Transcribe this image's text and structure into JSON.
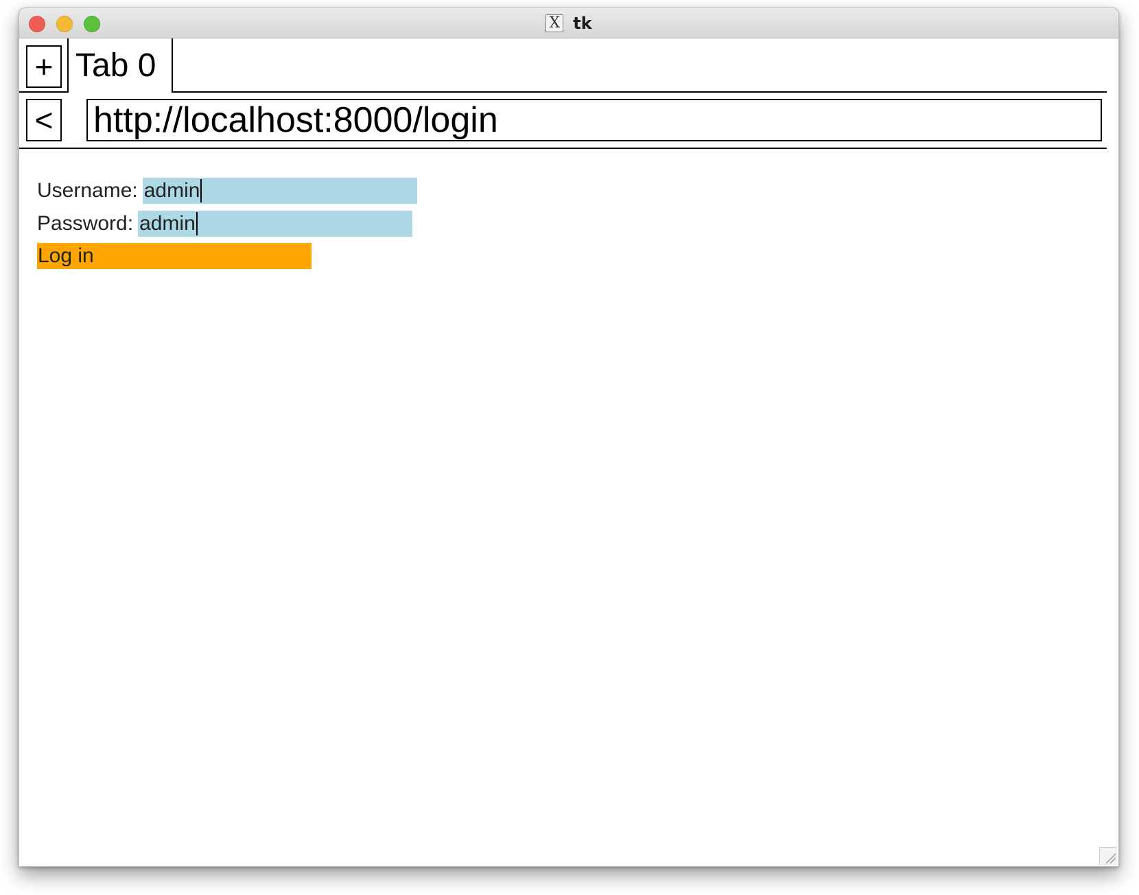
{
  "window": {
    "title": "tk",
    "title_icon": "x11-icon"
  },
  "tabbar": {
    "new_tab_label": "+",
    "tabs": [
      {
        "label": "Tab 0",
        "active": true
      }
    ]
  },
  "addressbar": {
    "back_label": "<",
    "url": "http://localhost:8000/login"
  },
  "form": {
    "username_label": "Username:",
    "username_value": "admin",
    "password_label": "Password:",
    "password_value": "admin",
    "submit_label": "Log in"
  },
  "colors": {
    "input_background": "#add8e6",
    "button_background": "#ffa500",
    "close_button": "#ed5f56",
    "minimize_button": "#f5b938",
    "maximize_button": "#5ec13e"
  }
}
